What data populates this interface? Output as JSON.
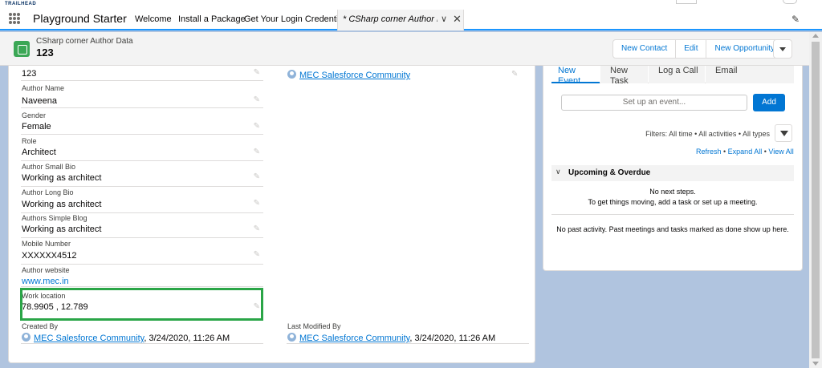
{
  "topbar": {
    "brand": "TRAILHEAD"
  },
  "nav": {
    "app_name": "Playground Starter",
    "items": [
      "Welcome",
      "Install a Package",
      "Get Your Login Credentials"
    ],
    "active_tab": "* CSharp corner Author Da...",
    "active_tab_menu": "chevron-down-icon",
    "active_tab_close": "close-icon",
    "edit_icon": "pencil-icon"
  },
  "record": {
    "object_label": "CSharp corner Author Data",
    "name": "123",
    "actions": [
      "New Contact",
      "Edit",
      "New Opportunity"
    ]
  },
  "details": {
    "top_value": "123",
    "owner_link": "MEC Salesforce Community",
    "fields": [
      {
        "label": "Author Name",
        "value": "Naveena"
      },
      {
        "label": "Gender",
        "value": "Female"
      },
      {
        "label": "Role",
        "value": "Architect"
      },
      {
        "label": "Author Small Bio",
        "value": "Working as architect"
      },
      {
        "label": "Author Long Bio",
        "value": "Working as architect"
      },
      {
        "label": "Authors Simple Blog",
        "value": "Working as architect"
      },
      {
        "label": "Mobile Number",
        "value": "XXXXXX4512"
      },
      {
        "label": "Author website",
        "value": "www.mec.in"
      },
      {
        "label": "Work location",
        "value": "78.9905 , 12.789"
      }
    ],
    "created_by_label": "Created By",
    "created_by_user": "MEC Salesforce Community",
    "created_by_date": ", 3/24/2020, 11:26 AM",
    "modified_by_label": "Last Modified By",
    "modified_by_user": "MEC Salesforce Community",
    "modified_by_date": ", 3/24/2020, 11:26 AM",
    "highlight_color": "#2aa547"
  },
  "activity": {
    "tabs": [
      "New Event",
      "New Task",
      "Log a Call",
      "Email"
    ],
    "event_placeholder": "Set up an event...",
    "add_label": "Add",
    "filters": "Filters: All time • All activities • All types",
    "refresh": "Refresh",
    "expand_all": "Expand All",
    "view_all": "View All",
    "sep": " • ",
    "upcoming_label": "Upcoming & Overdue",
    "no_steps": "No next steps.",
    "no_steps_hint": "To get things moving, add a task or set up a meeting.",
    "no_past": "No past activity. Past meetings and tasks marked as done show up here."
  },
  "colors": {
    "accent": "#0176d3",
    "background": "#b0c4df",
    "record_icon": "#3ba755"
  }
}
